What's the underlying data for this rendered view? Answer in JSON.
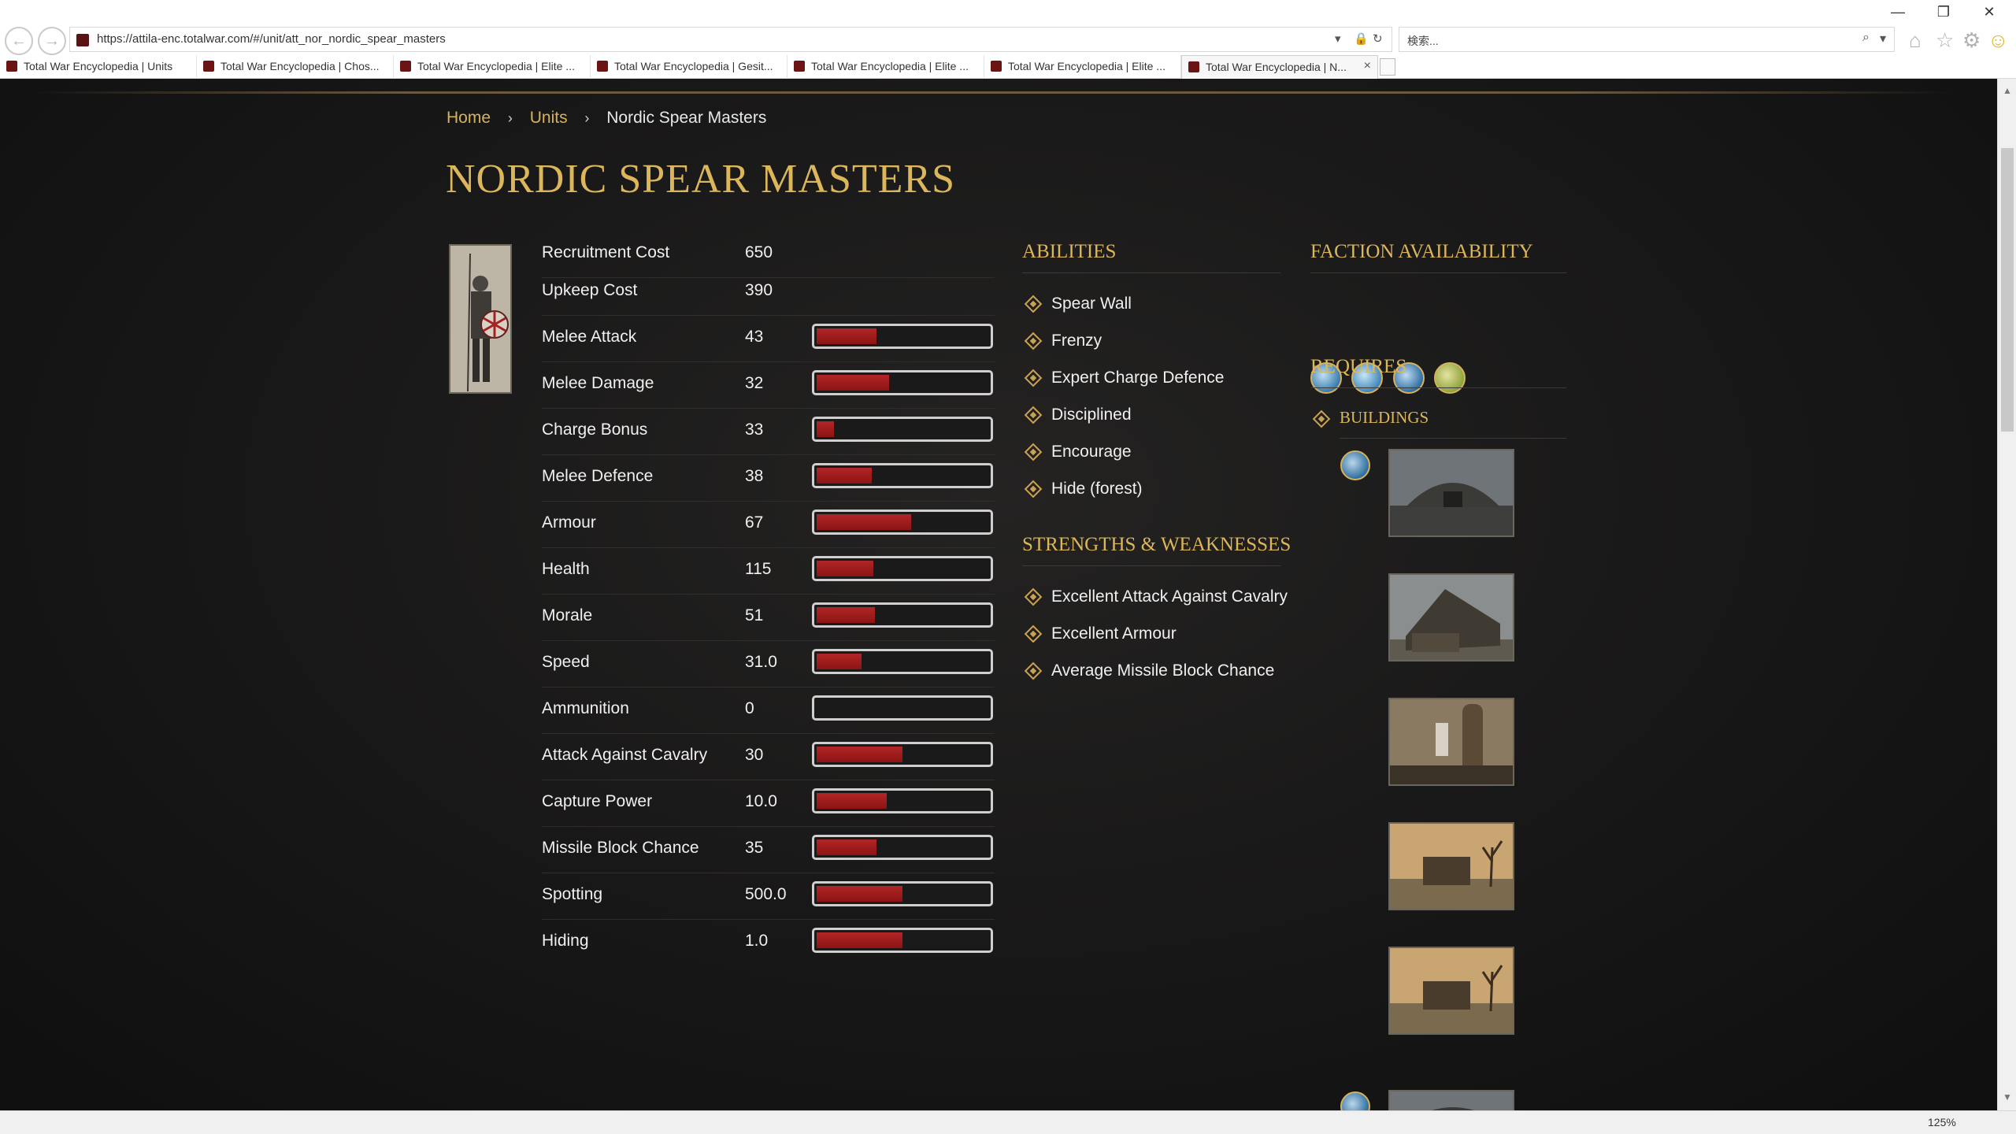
{
  "browser": {
    "url": "https://attila-enc.totalwar.com/#/unit/att_nor_nordic_spear_masters",
    "search_placeholder": "検索...",
    "zoom": "125%",
    "window_controls": {
      "minimize": "—",
      "restore": "❐",
      "close": "✕"
    },
    "tabs": [
      {
        "label": "Total War Encyclopedia | Units"
      },
      {
        "label": "Total War Encyclopedia | Chos..."
      },
      {
        "label": "Total War Encyclopedia | Elite ..."
      },
      {
        "label": "Total War Encyclopedia | Gesit..."
      },
      {
        "label": "Total War Encyclopedia | Elite ..."
      },
      {
        "label": "Total War Encyclopedia | Elite ..."
      },
      {
        "label": "Total War Encyclopedia | N...",
        "active": true
      }
    ]
  },
  "breadcrumb": {
    "home": "Home",
    "units": "Units",
    "current": "Nordic Spear Masters",
    "separator": "›"
  },
  "page_title": "NORDIC SPEAR MASTERS",
  "stats": [
    {
      "label": "Recruitment Cost",
      "value": "650"
    },
    {
      "label": "Upkeep Cost",
      "value": "390"
    },
    {
      "label": "Melee Attack",
      "value": "43",
      "fill": 0.35
    },
    {
      "label": "Melee Damage",
      "value": "32",
      "fill": 0.42
    },
    {
      "label": "Charge Bonus",
      "value": "33",
      "fill": 0.1
    },
    {
      "label": "Melee Defence",
      "value": "38",
      "fill": 0.32
    },
    {
      "label": "Armour",
      "value": "67",
      "fill": 0.55
    },
    {
      "label": "Health",
      "value": "115",
      "fill": 0.33
    },
    {
      "label": "Morale",
      "value": "51",
      "fill": 0.34
    },
    {
      "label": "Speed",
      "value": "31.0",
      "fill": 0.26
    },
    {
      "label": "Ammunition",
      "value": "0",
      "fill": 0.0
    },
    {
      "label": "Attack Against Cavalry",
      "value": "30",
      "fill": 0.5
    },
    {
      "label": "Capture Power",
      "value": "10.0",
      "fill": 0.41
    },
    {
      "label": "Missile Block Chance",
      "value": "35",
      "fill": 0.35
    },
    {
      "label": "Spotting",
      "value": "500.0",
      "fill": 0.5
    },
    {
      "label": "Hiding",
      "value": "1.0",
      "fill": 0.5
    }
  ],
  "abilities": {
    "title": "ABILITIES",
    "items": [
      "Spear Wall",
      "Frenzy",
      "Expert Charge Defence",
      "Disciplined",
      "Encourage",
      "Hide (forest)"
    ]
  },
  "strengths": {
    "title": "STRENGTHS & WEAKNESSES",
    "items": [
      "Excellent Attack Against Cavalry",
      "Excellent Armour",
      "Average Missile Block Chance"
    ]
  },
  "faction_availability": {
    "title": "FACTION AVAILABILITY",
    "icons": [
      "faction-icon-1",
      "faction-icon-2",
      "faction-icon-3",
      "faction-icon-4"
    ]
  },
  "requires": {
    "title": "REQUIRES",
    "buildings_label": "BUILDINGS"
  },
  "colors": {
    "gold": "#dcb65a",
    "bar_fill": "#a21e1e",
    "background": "#1a1919"
  }
}
